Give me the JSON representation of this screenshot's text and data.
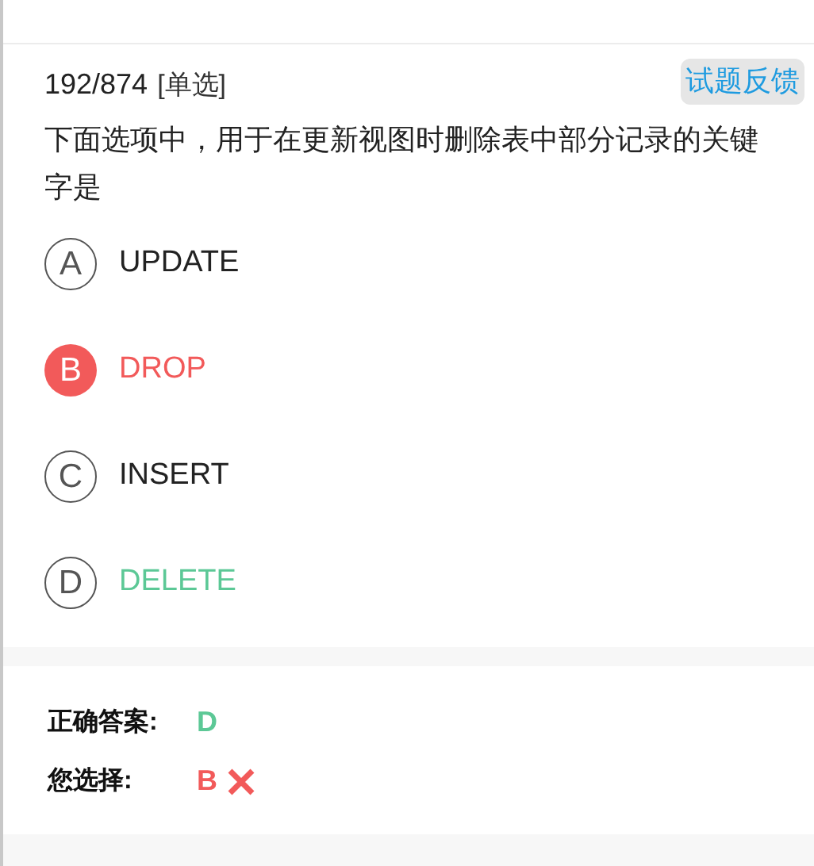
{
  "question": {
    "counter": "192/874",
    "type_tag": "[单选]",
    "feedback_button": "试题反馈",
    "text": "下面选项中，用于在更新视图时删除表中部分记录的关键字是"
  },
  "options": [
    {
      "letter": "A",
      "label": "UPDATE",
      "selected": false,
      "correct": false
    },
    {
      "letter": "B",
      "label": "DROP",
      "selected": true,
      "correct": false
    },
    {
      "letter": "C",
      "label": "INSERT",
      "selected": false,
      "correct": false
    },
    {
      "letter": "D",
      "label": "DELETE",
      "selected": false,
      "correct": true
    }
  ],
  "result": {
    "correct_label": "正确答案:",
    "correct_value": "D",
    "your_label": "您选择:",
    "your_value": "B",
    "your_correct": false
  }
}
